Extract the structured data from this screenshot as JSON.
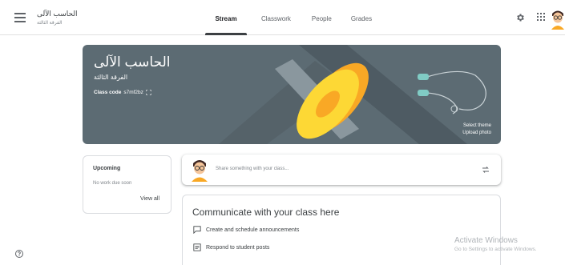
{
  "header": {
    "class_title": "الحاسب الآلى",
    "class_subtitle": "الفرقة الثالثة",
    "tabs": [
      {
        "label": "Stream",
        "active": true
      },
      {
        "label": "Classwork",
        "active": false
      },
      {
        "label": "People",
        "active": false
      },
      {
        "label": "Grades",
        "active": false
      }
    ],
    "icons": [
      "menu-icon",
      "gear-icon",
      "apps-grid-icon",
      "avatar"
    ]
  },
  "banner": {
    "title": "الحاسب الآلى",
    "subtitle": "الفرقة الثالثة",
    "class_code_label": "Class code",
    "class_code_value": "s7mf2bz",
    "select_theme": "Select theme",
    "upload_photo": "Upload photo",
    "background_color": "#5c6b73",
    "accent_color": "#fdd835"
  },
  "upcoming": {
    "title": "Upcoming",
    "empty_text": "No work due soon",
    "view_all": "View all"
  },
  "share": {
    "placeholder": "Share something with your class..."
  },
  "communicate": {
    "title": "Communicate with your class here",
    "items": [
      {
        "label": "Create and schedule announcements",
        "icon": "chat-bubble-icon"
      },
      {
        "label": "Respond to student posts",
        "icon": "post-icon"
      }
    ]
  },
  "watermark": {
    "line1": "Activate Windows",
    "line2": "Go to Settings to activate Windows."
  }
}
